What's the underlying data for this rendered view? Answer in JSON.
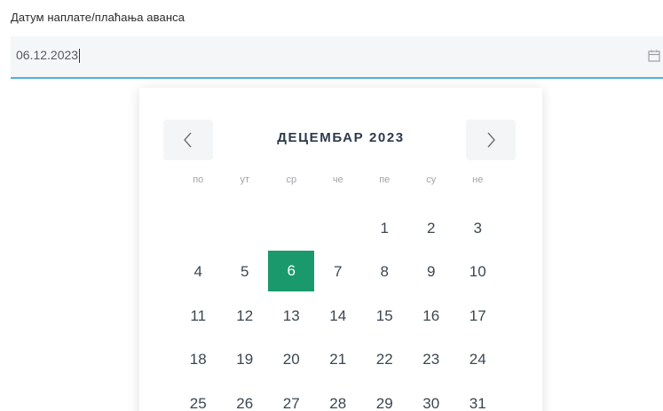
{
  "field": {
    "label": "Датум наплате/плаћања аванса",
    "value": "06.12.2023",
    "icon": "calendar-icon"
  },
  "datepicker": {
    "month_title": "ДЕЦЕМБАР 2023",
    "prev_icon": "chevron-left-icon",
    "next_icon": "chevron-right-icon",
    "weekdays": [
      "по",
      "ут",
      "ср",
      "че",
      "пе",
      "су",
      "не"
    ],
    "leading_blanks": 4,
    "days": [
      "1",
      "2",
      "3",
      "4",
      "5",
      "6",
      "7",
      "8",
      "9",
      "10",
      "11",
      "12",
      "13",
      "14",
      "15",
      "16",
      "17",
      "18",
      "19",
      "20",
      "21",
      "22",
      "23",
      "24",
      "25",
      "26",
      "27",
      "28",
      "29",
      "30",
      "31"
    ],
    "selected_day": "6",
    "selected_color": "#1a9a6c"
  },
  "colors": {
    "input_underline": "#4db3d9",
    "input_background": "#f5f6f8"
  }
}
